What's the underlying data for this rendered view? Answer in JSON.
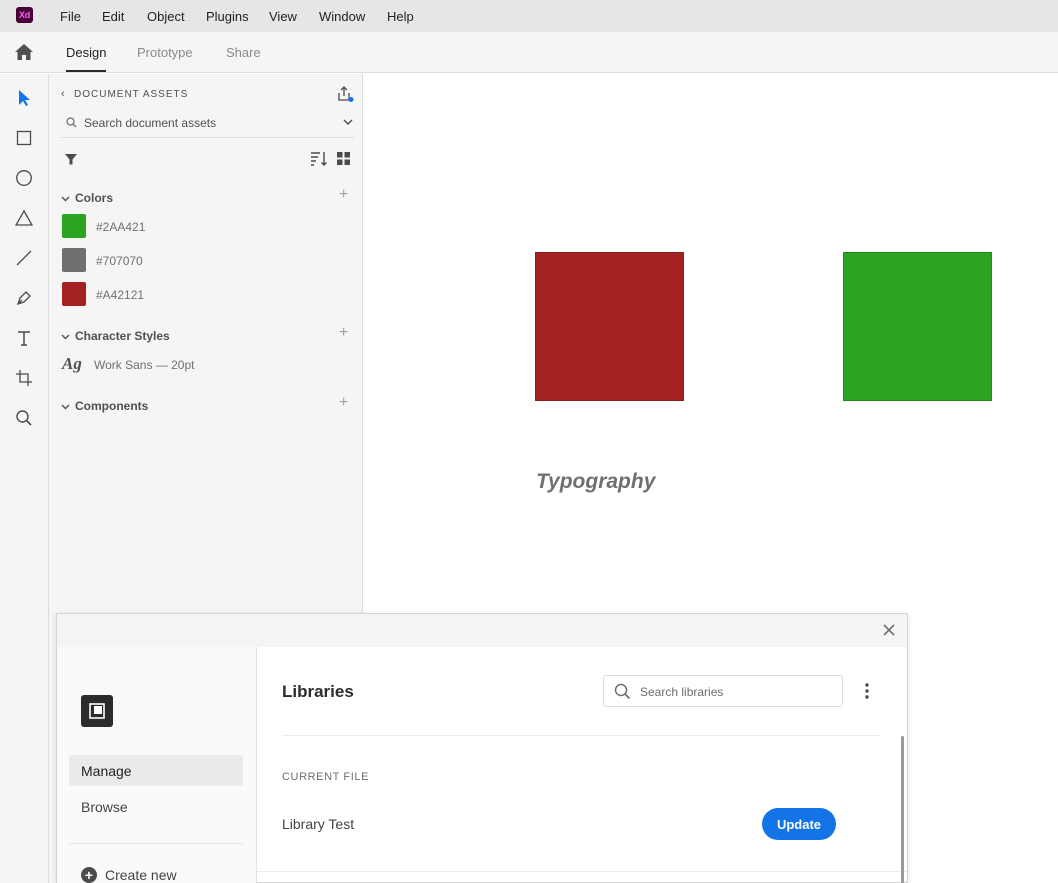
{
  "app": {
    "logo_text": "Xd"
  },
  "menubar": {
    "items": [
      "File",
      "Edit",
      "Object",
      "Plugins",
      "View",
      "Window",
      "Help"
    ]
  },
  "modes": {
    "tabs": [
      "Design",
      "Prototype",
      "Share"
    ],
    "active": "Design"
  },
  "toolbar": {
    "tools": [
      "select-icon",
      "rectangle-icon",
      "ellipse-icon",
      "polygon-icon",
      "line-icon",
      "pen-icon",
      "text-icon",
      "artboard-icon",
      "zoom-icon"
    ]
  },
  "assets": {
    "title": "DOCUMENT ASSETS",
    "search_placeholder": "Search document assets",
    "sections": {
      "colors": "Colors",
      "character_styles": "Character Styles",
      "components": "Components"
    },
    "colors": [
      {
        "label": "#2AA421",
        "hex": "#2AA421"
      },
      {
        "label": "#707070",
        "hex": "#707070"
      },
      {
        "label": "#A42121",
        "hex": "#A42121"
      }
    ],
    "character_style": {
      "preview": "Ag",
      "label": "Work Sans — 20pt"
    }
  },
  "canvas": {
    "red_square_color": "#A42121",
    "green_square_color": "#2AA421",
    "text": "Typography"
  },
  "libraries": {
    "title": "Libraries",
    "search_placeholder": "Search libraries",
    "nav": {
      "manage": "Manage",
      "browse": "Browse",
      "create_new": "Create new"
    },
    "current_file_label": "CURRENT FILE",
    "library_name": "Library Test",
    "update_label": "Update",
    "update_color": "#1473E6"
  }
}
